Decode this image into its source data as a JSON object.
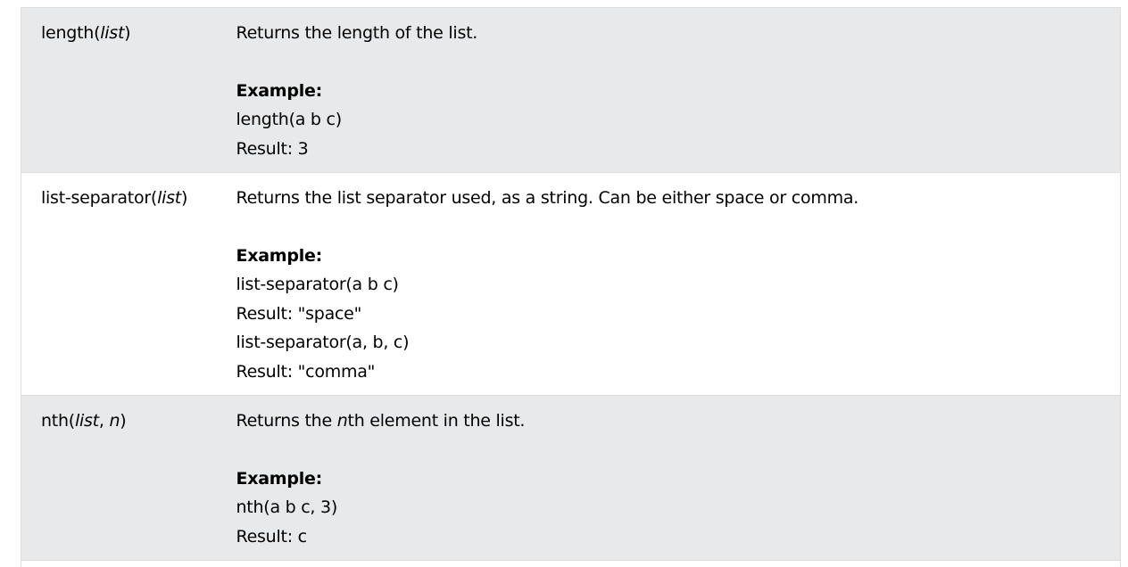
{
  "rows": [
    {
      "fn_name": "length",
      "fn_open": "(",
      "fn_arg1": "list",
      "fn_close": ")",
      "description": "Returns the length of the list.",
      "example_label": "Example:",
      "examples": [
        "length(a b c)",
        "Result: 3"
      ]
    },
    {
      "fn_name": "list-separator",
      "fn_open": "(",
      "fn_arg1": "list",
      "fn_close": ")",
      "description": "Returns the list separator used, as a string. Can be either space or comma.",
      "example_label": "Example:",
      "examples": [
        "list-separator(a b c)",
        "Result: \"space\"",
        "list-separator(a, b, c)",
        "Result: \"comma\""
      ]
    },
    {
      "fn_name": "nth",
      "fn_open": "(",
      "fn_arg1": "list",
      "fn_sep": ", ",
      "fn_arg2": "n",
      "fn_close": ")",
      "description_before": "Returns the ",
      "description_em": "n",
      "description_after": "th element in the list.",
      "example_label": "Example:",
      "examples": [
        "nth(a b c, 3)",
        "Result: c"
      ]
    }
  ]
}
